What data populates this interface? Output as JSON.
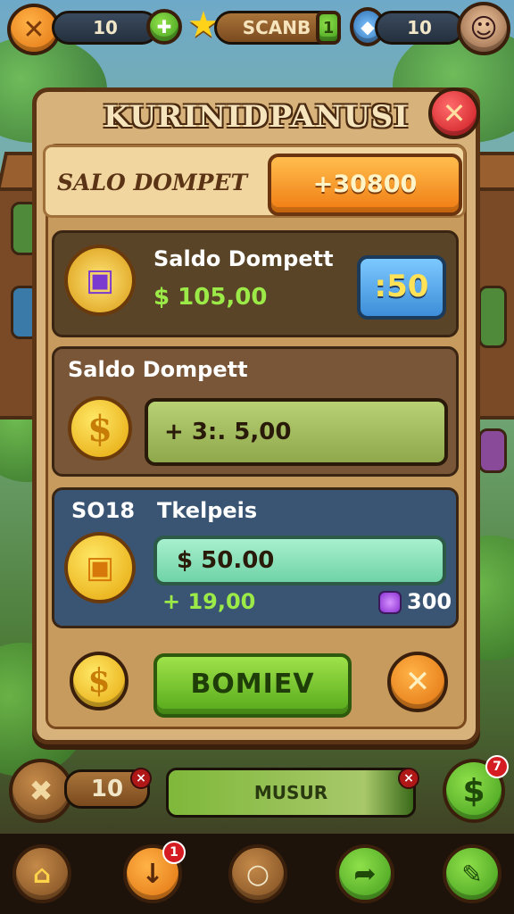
{
  "hud_top": {
    "left_value": "10",
    "center_label": "SCANB",
    "center_badge": "1",
    "right_value": "10"
  },
  "dialog": {
    "title": "KURINIDPANUSI",
    "wallet_label": "SALO DOMPET",
    "wallet_value": "+30800",
    "card1": {
      "title": "Saldo Dompett",
      "amount": "$ 105,00",
      "button_label": ":50"
    },
    "card2": {
      "title": "Saldo Dompett",
      "field_value": "+ 3:. 5,00"
    },
    "card3": {
      "left_label": "SO18",
      "title": "Tkelpeis",
      "field_value": "$ 50.00",
      "bonus": "+ 19,00",
      "gem_count": "300"
    },
    "primary_button": "BOMIEV"
  },
  "hud_bottom": {
    "left_value": "10",
    "center_label": "MUSUR",
    "right_badge": "7",
    "nav_badge": "1"
  },
  "colors": {
    "panel": "#d7b27a",
    "accent_orange": "#f07b12",
    "accent_green": "#55a81a",
    "close_red": "#c8161d"
  }
}
